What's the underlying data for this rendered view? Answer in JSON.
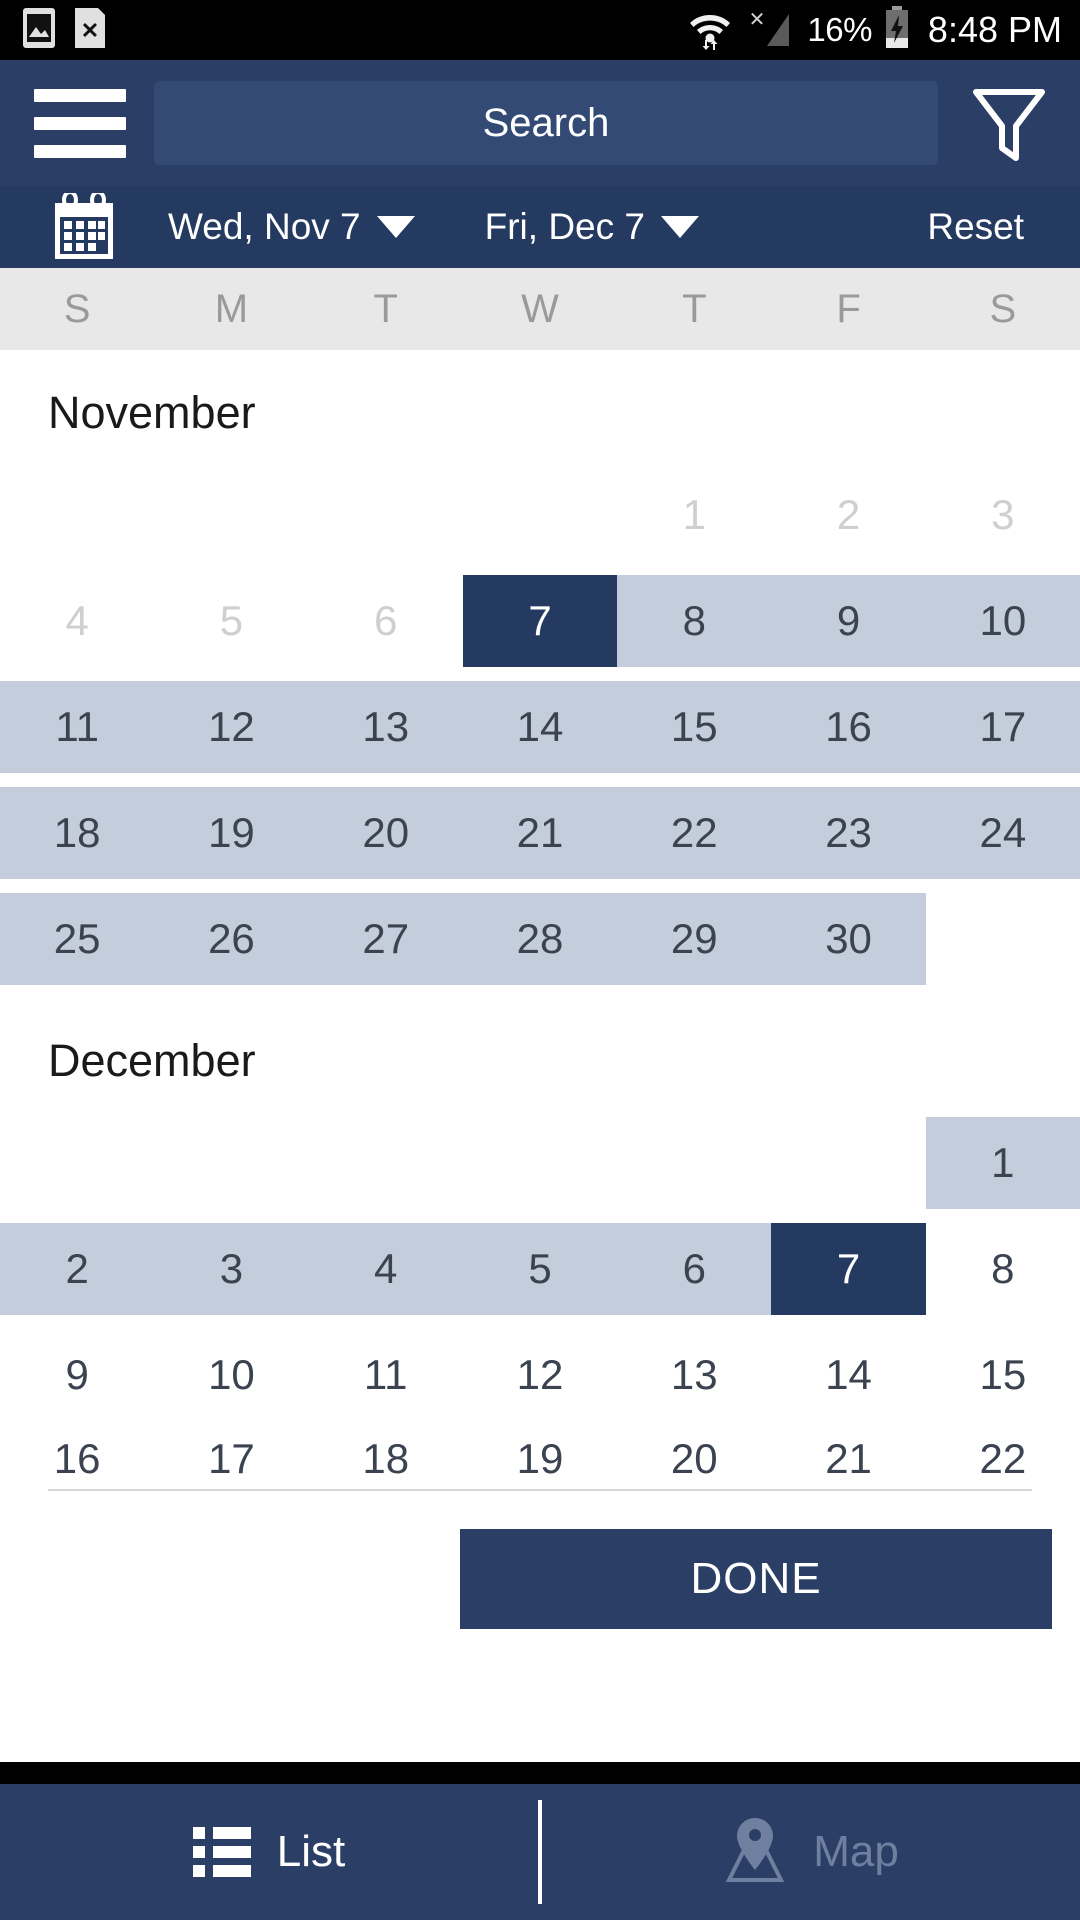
{
  "statusbar": {
    "icons": [
      "image-icon",
      "sim-card-x-icon",
      "wifi-icon",
      "signal-x-icon"
    ],
    "battery_percent": "16%",
    "battery_state": "charging",
    "clock": "8:48 PM"
  },
  "header": {
    "menu_icon": "hamburger-menu-icon",
    "search_placeholder": "Search",
    "filter_icon": "filter-funnel-icon"
  },
  "datebar": {
    "calendar_icon": "calendar-icon",
    "start_date": "Wed, Nov 7",
    "end_date": "Fri, Dec 7",
    "reset_label": "Reset"
  },
  "weekdays": [
    "S",
    "M",
    "T",
    "W",
    "T",
    "F",
    "S"
  ],
  "colors": {
    "appbar": "#2b3f66",
    "datebar": "#253a61",
    "selected": "#253a61",
    "in_range": "#c4cddb",
    "weekday_header_bg": "#e8e8e8",
    "muted_day": "#cfcfcf"
  },
  "months": [
    {
      "name": "November",
      "weeks": [
        [
          {
            "label": "",
            "state": "empty"
          },
          {
            "label": "",
            "state": "empty"
          },
          {
            "label": "",
            "state": "empty"
          },
          {
            "label": "",
            "state": "empty"
          },
          {
            "label": "1",
            "state": "muted"
          },
          {
            "label": "2",
            "state": "muted"
          },
          {
            "label": "3",
            "state": "muted"
          }
        ],
        [
          {
            "label": "4",
            "state": "muted"
          },
          {
            "label": "5",
            "state": "muted"
          },
          {
            "label": "6",
            "state": "muted"
          },
          {
            "label": "7",
            "state": "selected"
          },
          {
            "label": "8",
            "state": "inrange"
          },
          {
            "label": "9",
            "state": "inrange"
          },
          {
            "label": "10",
            "state": "inrange"
          }
        ],
        [
          {
            "label": "11",
            "state": "inrange"
          },
          {
            "label": "12",
            "state": "inrange"
          },
          {
            "label": "13",
            "state": "inrange"
          },
          {
            "label": "14",
            "state": "inrange"
          },
          {
            "label": "15",
            "state": "inrange"
          },
          {
            "label": "16",
            "state": "inrange"
          },
          {
            "label": "17",
            "state": "inrange"
          }
        ],
        [
          {
            "label": "18",
            "state": "inrange"
          },
          {
            "label": "19",
            "state": "inrange"
          },
          {
            "label": "20",
            "state": "inrange"
          },
          {
            "label": "21",
            "state": "inrange"
          },
          {
            "label": "22",
            "state": "inrange"
          },
          {
            "label": "23",
            "state": "inrange"
          },
          {
            "label": "24",
            "state": "inrange"
          }
        ],
        [
          {
            "label": "25",
            "state": "inrange"
          },
          {
            "label": "26",
            "state": "inrange"
          },
          {
            "label": "27",
            "state": "inrange"
          },
          {
            "label": "28",
            "state": "inrange"
          },
          {
            "label": "29",
            "state": "inrange"
          },
          {
            "label": "30",
            "state": "inrange"
          },
          {
            "label": "",
            "state": "empty"
          }
        ]
      ]
    },
    {
      "name": "December",
      "weeks": [
        [
          {
            "label": "",
            "state": "empty"
          },
          {
            "label": "",
            "state": "empty"
          },
          {
            "label": "",
            "state": "empty"
          },
          {
            "label": "",
            "state": "empty"
          },
          {
            "label": "",
            "state": "empty"
          },
          {
            "label": "",
            "state": "empty"
          },
          {
            "label": "1",
            "state": "inrange"
          }
        ],
        [
          {
            "label": "2",
            "state": "inrange"
          },
          {
            "label": "3",
            "state": "inrange"
          },
          {
            "label": "4",
            "state": "inrange"
          },
          {
            "label": "5",
            "state": "inrange"
          },
          {
            "label": "6",
            "state": "inrange"
          },
          {
            "label": "7",
            "state": "selected"
          },
          {
            "label": "8",
            "state": "normal"
          }
        ],
        [
          {
            "label": "9",
            "state": "normal"
          },
          {
            "label": "10",
            "state": "normal"
          },
          {
            "label": "11",
            "state": "normal"
          },
          {
            "label": "12",
            "state": "normal"
          },
          {
            "label": "13",
            "state": "normal"
          },
          {
            "label": "14",
            "state": "normal"
          },
          {
            "label": "15",
            "state": "normal"
          }
        ],
        [
          {
            "label": "16",
            "state": "normal"
          },
          {
            "label": "17",
            "state": "normal"
          },
          {
            "label": "18",
            "state": "normal"
          },
          {
            "label": "19",
            "state": "normal"
          },
          {
            "label": "20",
            "state": "normal"
          },
          {
            "label": "21",
            "state": "normal"
          },
          {
            "label": "22",
            "state": "normal"
          }
        ]
      ]
    }
  ],
  "done_button": {
    "label": "DONE"
  },
  "bottomnav": {
    "items": [
      {
        "label": "List",
        "icon": "list-icon",
        "active": true
      },
      {
        "label": "Map",
        "icon": "map-pin-icon",
        "active": false
      }
    ]
  }
}
